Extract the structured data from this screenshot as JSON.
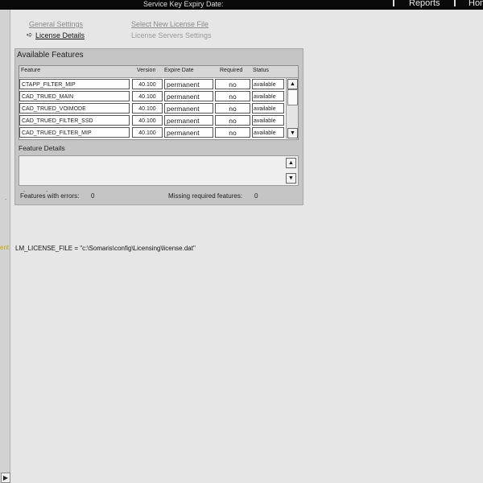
{
  "header": {
    "service_key_label": "Service Key Expiry Date:",
    "nav": [
      "Reports",
      "Hom"
    ]
  },
  "tabs": {
    "general_settings": "General Settings",
    "select_new_license_file": "Select New License File",
    "license_details": "License Details",
    "license_servers_settings": "License Servers Settings"
  },
  "available_features": {
    "title": "Available Features",
    "columns": [
      "Feature",
      "Version",
      "Expire Date",
      "Required",
      "Status"
    ],
    "rows": [
      [
        "CTAPP_FILTER_MIP",
        "40.100",
        "permanent",
        "no",
        "available"
      ],
      [
        "CAD_TRUED_MAIN",
        "40.100",
        "permanent",
        "no",
        "available"
      ],
      [
        "CAD_TRUED_VOIMODE",
        "40.100",
        "permanent",
        "no",
        "available"
      ],
      [
        "CAD_TRUED_FILTER_SSD",
        "40.100",
        "permanent",
        "no",
        "available"
      ],
      [
        "CAD_TRUED_FILTER_MIP",
        "40.100",
        "permanent",
        "no",
        "available"
      ]
    ]
  },
  "feature_details": {
    "label": "Feature Details"
  },
  "status_bar": {
    "errors_label": "Features with errors:",
    "errors_value": "0",
    "missing_label": "Missing required features:",
    "missing_value": "0"
  },
  "license_file_line": "LM_LICENSE_FILE = \"c:\\Somaris\\config\\Licensing\\license.dat\"",
  "left_strip": {
    "marker": "ent"
  }
}
